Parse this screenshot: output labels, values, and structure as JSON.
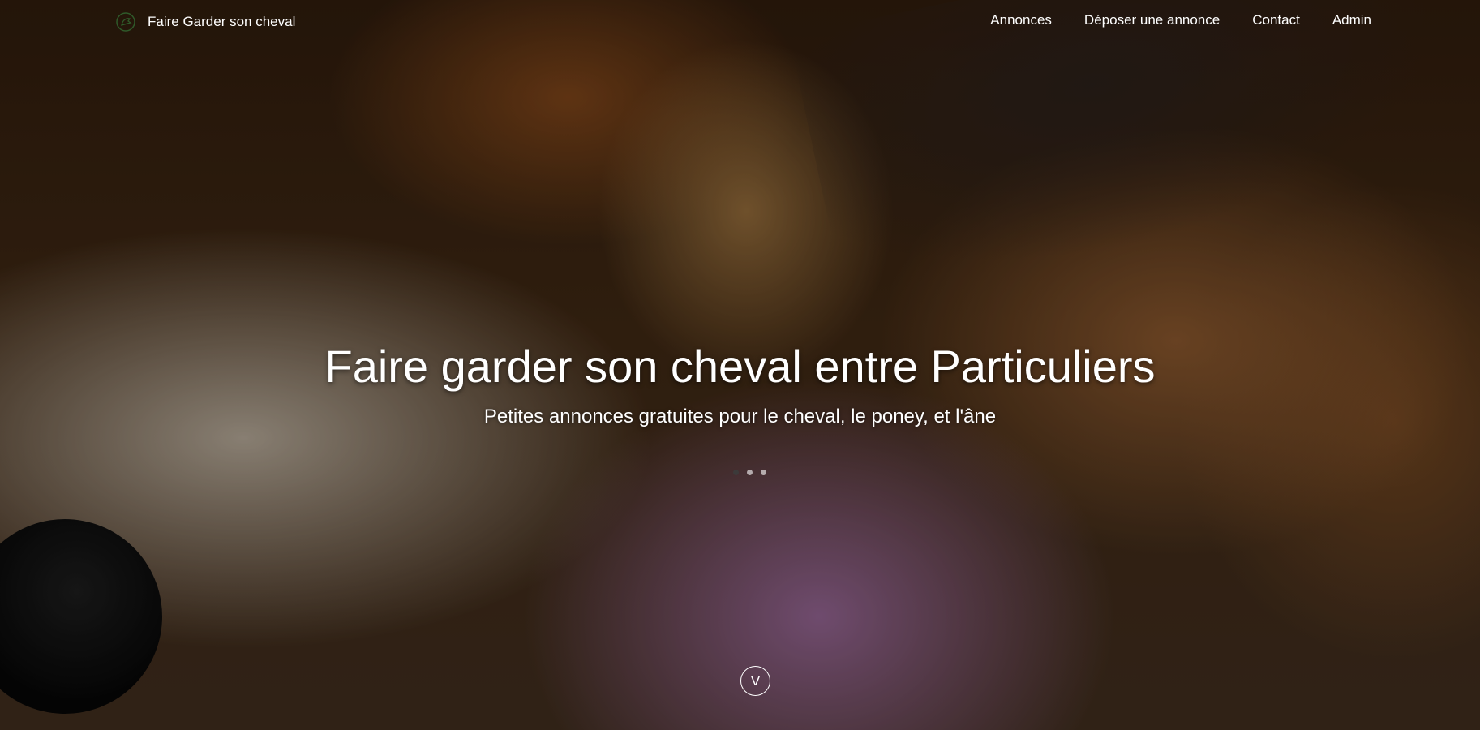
{
  "brand": {
    "name": "Faire Garder son cheval",
    "logo_icon": "horse-head-icon"
  },
  "nav": {
    "items": [
      {
        "label": "Annonces"
      },
      {
        "label": "Déposer une annonce"
      },
      {
        "label": "Contact"
      },
      {
        "label": "Admin"
      }
    ]
  },
  "hero": {
    "title": "Faire garder son cheval entre Particuliers",
    "subtitle": "Petites annonces gratuites pour le cheval, le poney, et l'âne",
    "carousel_slides": 3,
    "active_slide": 1,
    "scroll_label": "V"
  }
}
